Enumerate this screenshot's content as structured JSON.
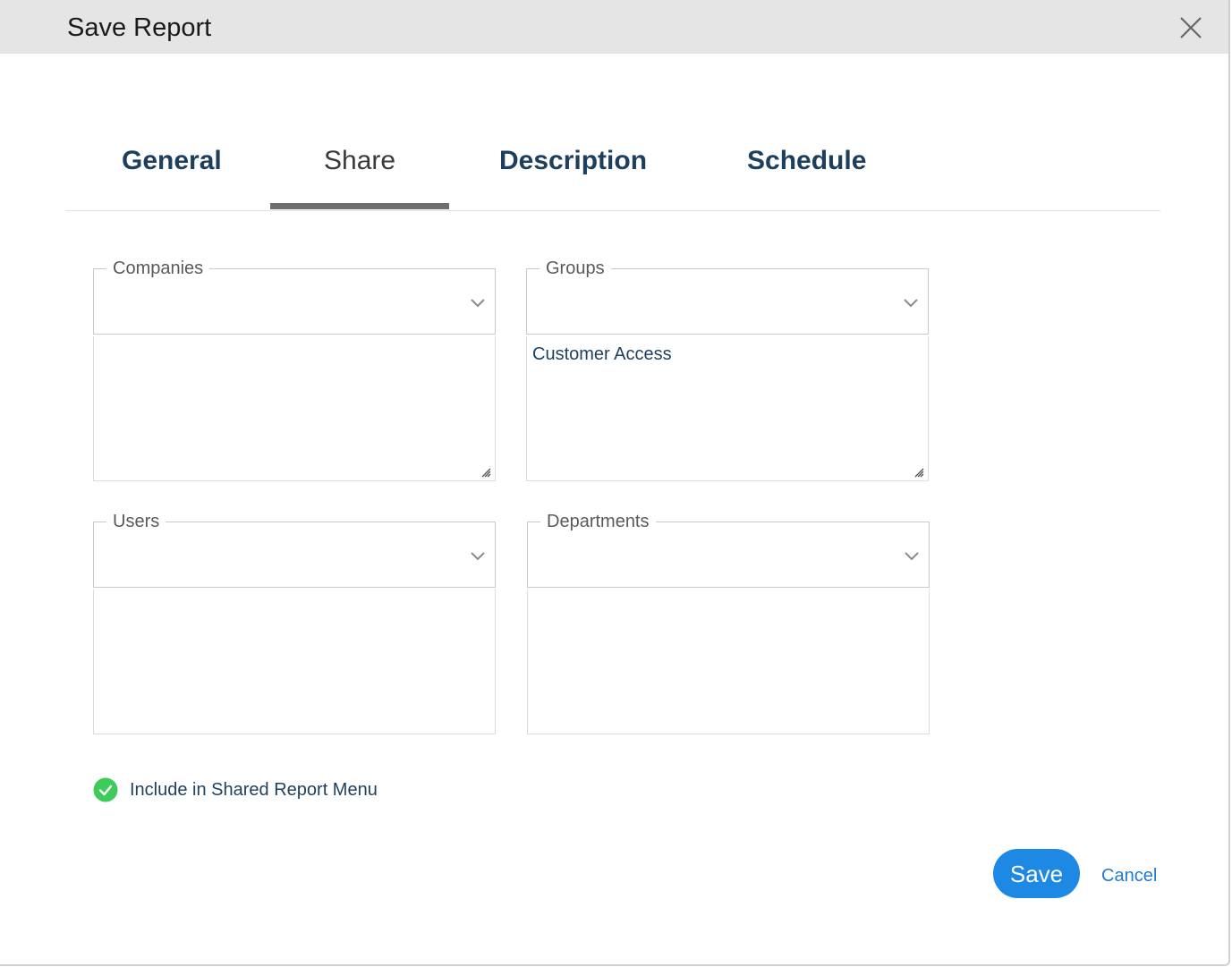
{
  "dialog": {
    "title": "Save Report",
    "close_icon": "close-icon"
  },
  "tabs": [
    {
      "label": "General",
      "active": false
    },
    {
      "label": "Share",
      "active": true
    },
    {
      "label": "Description",
      "active": false
    },
    {
      "label": "Schedule",
      "active": false
    }
  ],
  "share": {
    "companies": {
      "label": "Companies",
      "selected": []
    },
    "groups": {
      "label": "Groups",
      "selected": [
        "Customer Access"
      ]
    },
    "users": {
      "label": "Users",
      "selected": []
    },
    "departments": {
      "label": "Departments",
      "selected": []
    },
    "include_shared_menu": {
      "label": "Include in Shared Report Menu",
      "checked": true
    }
  },
  "footer": {
    "save_label": "Save",
    "cancel_label": "Cancel"
  },
  "colors": {
    "title_bar": "#e5e5e5",
    "tab_text": "#1d3f5e",
    "accent": "#1e88e5",
    "check": "#3ecb5a"
  }
}
